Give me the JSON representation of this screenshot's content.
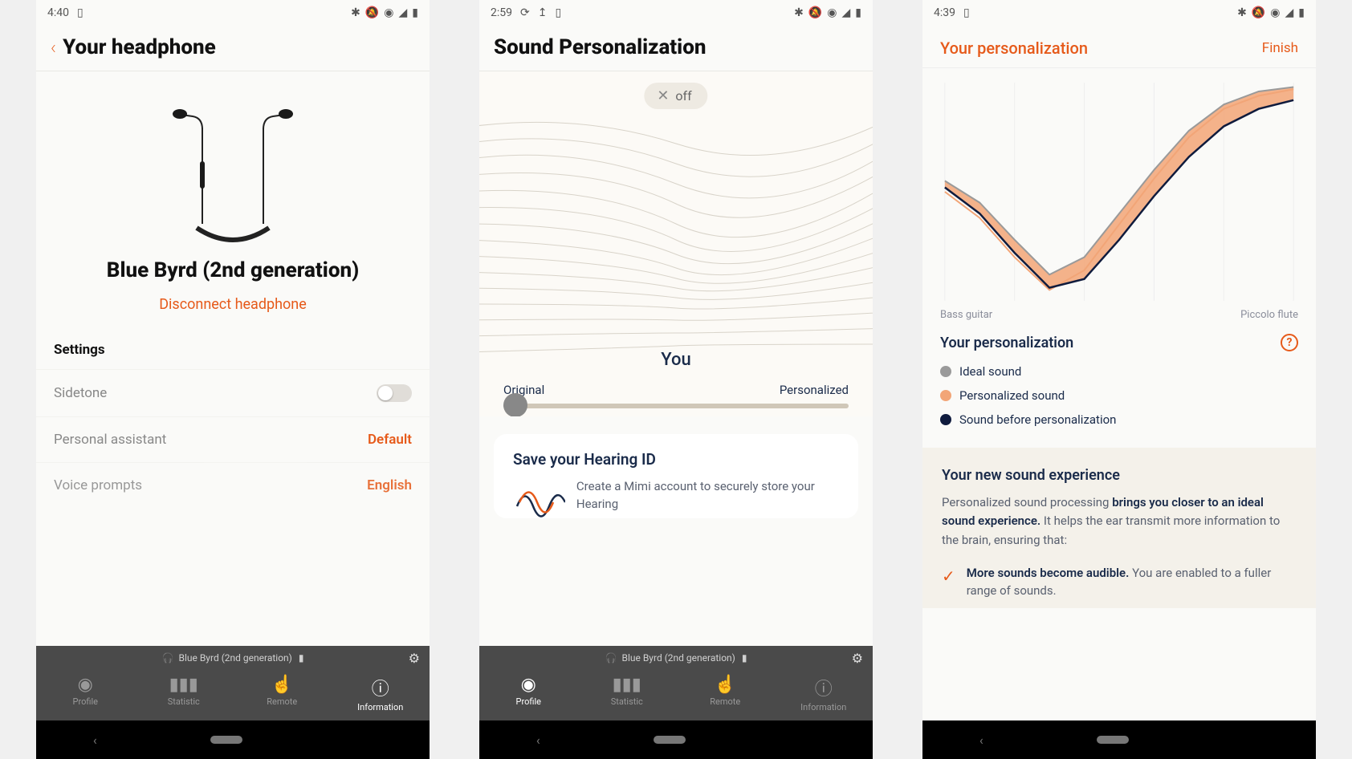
{
  "screen1": {
    "time": "4:40",
    "title": "Your headphone",
    "product_name": "Blue Byrd (2nd generation)",
    "disconnect": "Disconnect headphone",
    "settings_hdr": "Settings",
    "rows": {
      "sidetone": "Sidetone",
      "assistant_label": "Personal assistant",
      "assistant_value": "Default",
      "voice_label": "Voice prompts",
      "voice_value": "English"
    },
    "device_strip": "Blue Byrd (2nd generation)",
    "tabs": {
      "profile": "Profile",
      "statistic": "Statistic",
      "remote": "Remote",
      "information": "Information"
    }
  },
  "screen2": {
    "time": "2:59",
    "title": "Sound Personalization",
    "off_label": "off",
    "you": "You",
    "slider_left": "Original",
    "slider_right": "Personalized",
    "card_title": "Save your Hearing ID",
    "card_text": "Create a Mimi account to securely store your Hearing",
    "device_strip": "Blue Byrd (2nd generation)",
    "tabs": {
      "profile": "Profile",
      "statistic": "Statistic",
      "remote": "Remote",
      "information": "Information"
    }
  },
  "screen3": {
    "time": "4:39",
    "title": "Your personalization",
    "finish": "Finish",
    "axis_left": "Bass guitar",
    "axis_right": "Piccolo flute",
    "legend_title": "Your personalization",
    "legend": {
      "ideal": "Ideal sound",
      "personalized": "Personalized sound",
      "before": "Sound before personalization"
    },
    "info_title": "Your new sound experience",
    "info_text_prefix": "Personalized sound processing ",
    "info_text_bold": "brings you closer to an ideal sound experience.",
    "info_text_suffix": " It helps the ear transmit more information to the brain, ensuring that:",
    "bullet_bold": "More sounds become audible.",
    "bullet_rest": " You are enabled to a fuller range of sounds."
  },
  "colors": {
    "accent": "#e65a1a",
    "peach": "#f2a577",
    "grey": "#9a9a9a",
    "navy": "#0f1b3d"
  },
  "chart_data": {
    "type": "line",
    "title": "Your personalization",
    "xlabel_left": "Bass guitar",
    "xlabel_right": "Piccolo flute",
    "x": [
      0,
      0.1,
      0.2,
      0.3,
      0.4,
      0.5,
      0.6,
      0.7,
      0.8,
      0.9,
      1.0
    ],
    "series": [
      {
        "name": "Ideal sound",
        "color": "#9a9a9a",
        "values": [
          0.55,
          0.45,
          0.28,
          0.12,
          0.2,
          0.4,
          0.6,
          0.78,
          0.9,
          0.96,
          0.98
        ]
      },
      {
        "name": "Personalized sound",
        "color": "#f2a577",
        "values": [
          0.5,
          0.38,
          0.2,
          0.05,
          0.14,
          0.35,
          0.56,
          0.75,
          0.88,
          0.94,
          0.97
        ]
      },
      {
        "name": "Sound before personalization",
        "color": "#0f1b3d",
        "values": [
          0.52,
          0.4,
          0.22,
          0.06,
          0.1,
          0.28,
          0.48,
          0.66,
          0.8,
          0.88,
          0.92
        ]
      }
    ],
    "ylim": [
      0,
      1
    ]
  }
}
